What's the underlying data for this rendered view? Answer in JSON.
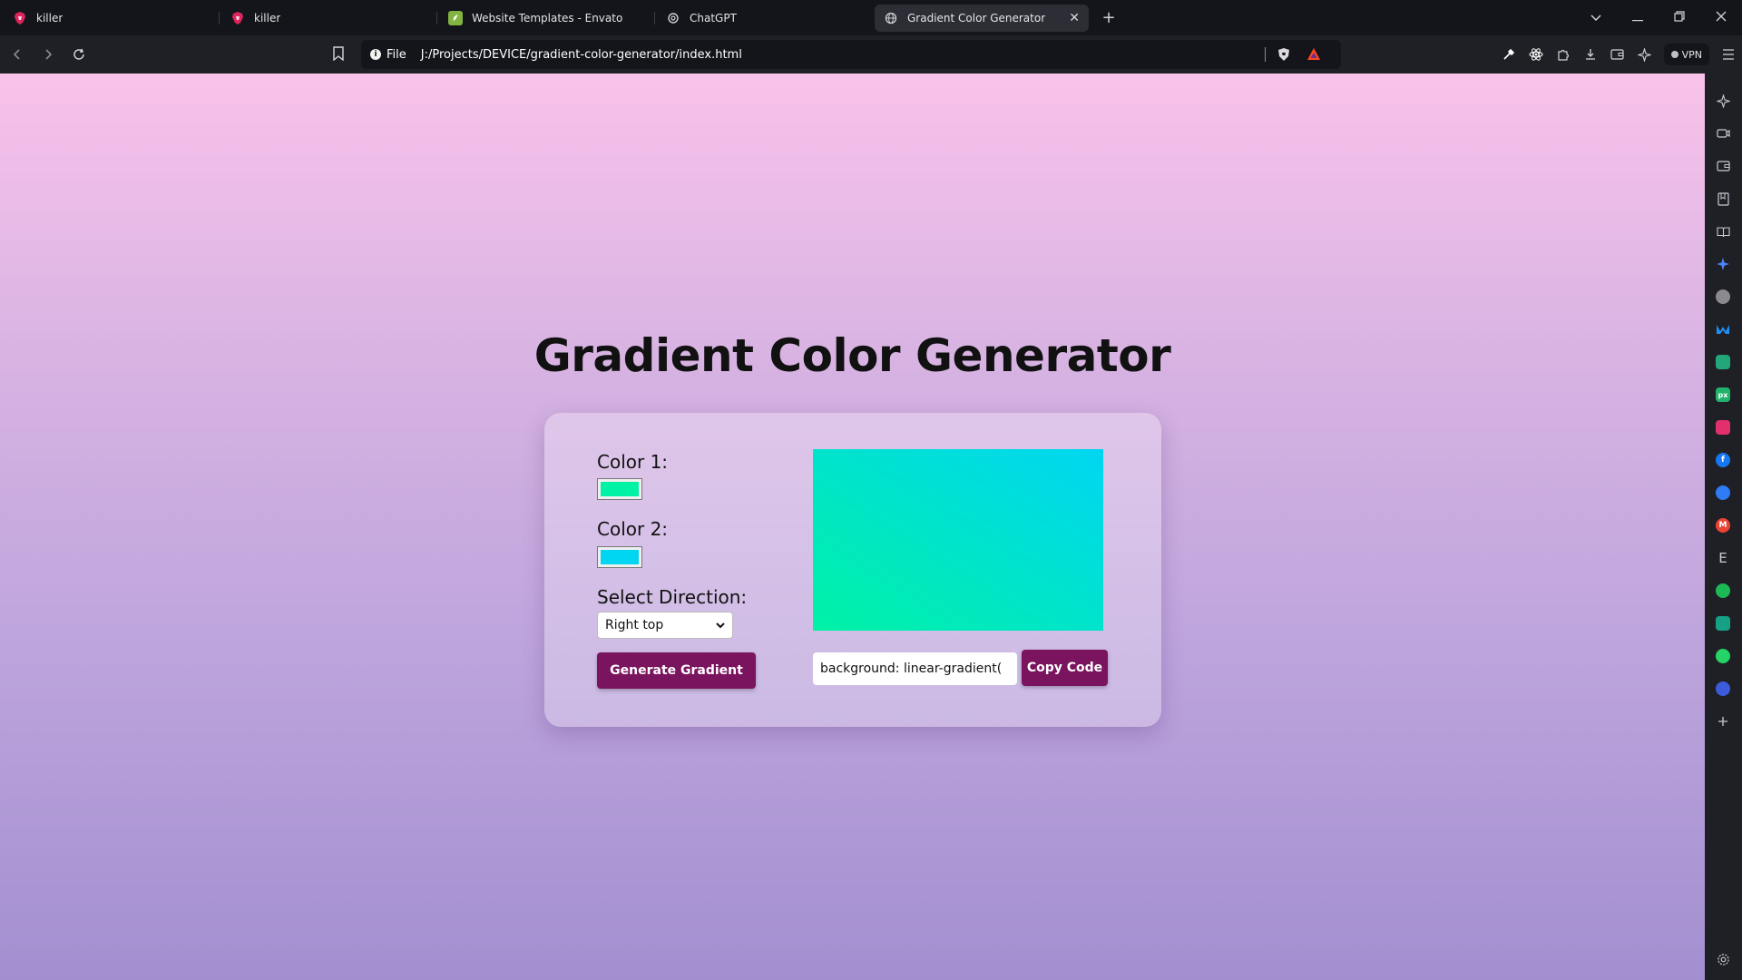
{
  "browser": {
    "tabs": [
      {
        "title": "killer",
        "icon": "brave-icon",
        "color": "#e0245e"
      },
      {
        "title": "killer",
        "icon": "brave-icon",
        "color": "#e0245e"
      },
      {
        "title": "Website Templates - Envato",
        "icon": "envato-icon",
        "color": "#81b441"
      },
      {
        "title": "ChatGPT",
        "icon": "chatgpt-icon",
        "color": "#cfcfd6"
      },
      {
        "title": "Gradient Color Generator",
        "icon": "globe-icon",
        "color": "#cfcfd6",
        "active": true
      }
    ],
    "new_tab": "+",
    "close_tab": "✕",
    "address": {
      "scheme": "File",
      "url": "J:/Projects/DEVICE/gradient-color-generator/index.html"
    },
    "vpn_label": "VPN"
  },
  "page": {
    "title": "Gradient Color Generator",
    "color1": {
      "label": "Color 1:",
      "value": "#00f2a5"
    },
    "color2": {
      "label": "Color 2:",
      "value": "#00d6f2"
    },
    "direction": {
      "label": "Select Direction:",
      "selected": "Right top"
    },
    "generate_button": "Generate Gradient",
    "code_value": "background: linear-gradient(",
    "copy_button": "Copy Code",
    "accent_color": "#7a145e"
  },
  "sidebar": {
    "items": [
      {
        "icon": "star-icon"
      },
      {
        "icon": "video-icon"
      },
      {
        "icon": "wallet-icon"
      },
      {
        "icon": "bookmarks-icon"
      },
      {
        "icon": "reading-list-icon"
      },
      {
        "icon": "leo-ai-icon",
        "color": "#4d84ff"
      },
      {
        "icon": "extension-icon",
        "color": "#8a8a8f"
      },
      {
        "icon": "malwarebytes-icon",
        "color": "#1f8ff2"
      },
      {
        "icon": "app-icon",
        "color": "#22a67a"
      },
      {
        "icon": "px-icon",
        "color": "#21b36b",
        "text": "px"
      },
      {
        "icon": "instagram-icon",
        "color": "#e1306c"
      },
      {
        "icon": "facebook-icon",
        "color": "#1877f2",
        "text": "f"
      },
      {
        "icon": "messenger-icon",
        "color": "#2e7bf6"
      },
      {
        "icon": "gmail-icon",
        "color": "#ea4335",
        "text": "M"
      },
      {
        "icon": "envato-e-icon",
        "text": "E"
      },
      {
        "icon": "spotify-icon",
        "color": "#1db954"
      },
      {
        "icon": "copilot-icon",
        "color": "#16a085"
      },
      {
        "icon": "whatsapp-icon",
        "color": "#25d366"
      },
      {
        "icon": "threads-icon",
        "color": "#3b5bdb"
      },
      {
        "icon": "plus-icon",
        "text": "+"
      }
    ],
    "settings_icon": "gear-icon"
  }
}
